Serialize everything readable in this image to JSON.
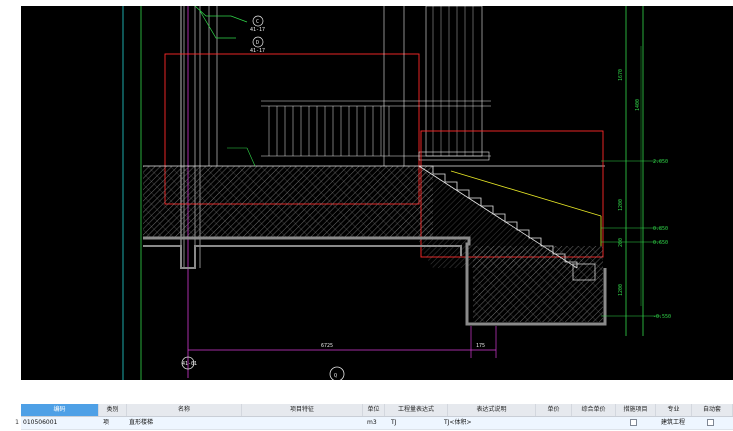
{
  "drawing": {
    "dims": {
      "d1": "6725",
      "d2": "175",
      "v1": "1670",
      "v2": "1400",
      "v3": "1200",
      "v4": "200",
      "v5": "1200"
    },
    "levels": [
      "2.050",
      "0.850",
      "0.650",
      "-0.550"
    ],
    "axis_labels": {
      "col_a": "C",
      "col_a_sub": "41-17",
      "col_b": "D",
      "col_b_sub": "41-17",
      "bubble_bottom_left": "41-01",
      "bubble_bottom": "Q"
    },
    "colors": {
      "red": "#ff2a2a",
      "green": "#31d84a",
      "cyan": "#25d5d5",
      "white": "#e8e8e8",
      "magenta": "#d43ad4",
      "yellow": "#e8e826",
      "grey": "#8a8a8a"
    }
  },
  "grid": {
    "columns": [
      {
        "label": "编码",
        "selected": true
      },
      {
        "label": "类别"
      },
      {
        "label": "名称"
      },
      {
        "label": "项目特征"
      },
      {
        "label": "单位"
      },
      {
        "label": "工程量表达式"
      },
      {
        "label": "表达式说明"
      },
      {
        "label": "单价"
      },
      {
        "label": "综合单价"
      },
      {
        "label": "措施项目"
      },
      {
        "label": "专业"
      },
      {
        "label": "自动套"
      }
    ],
    "rows": [
      {
        "num": "1",
        "code": "010506001",
        "category": "项",
        "name": "直形楼梯",
        "feature": "",
        "unit": "m3",
        "expr": "TJ",
        "expr_desc": "TJ<体积>",
        "price": "",
        "composite_price": "",
        "measure": false,
        "major": "建筑工程",
        "auto": false
      }
    ]
  }
}
